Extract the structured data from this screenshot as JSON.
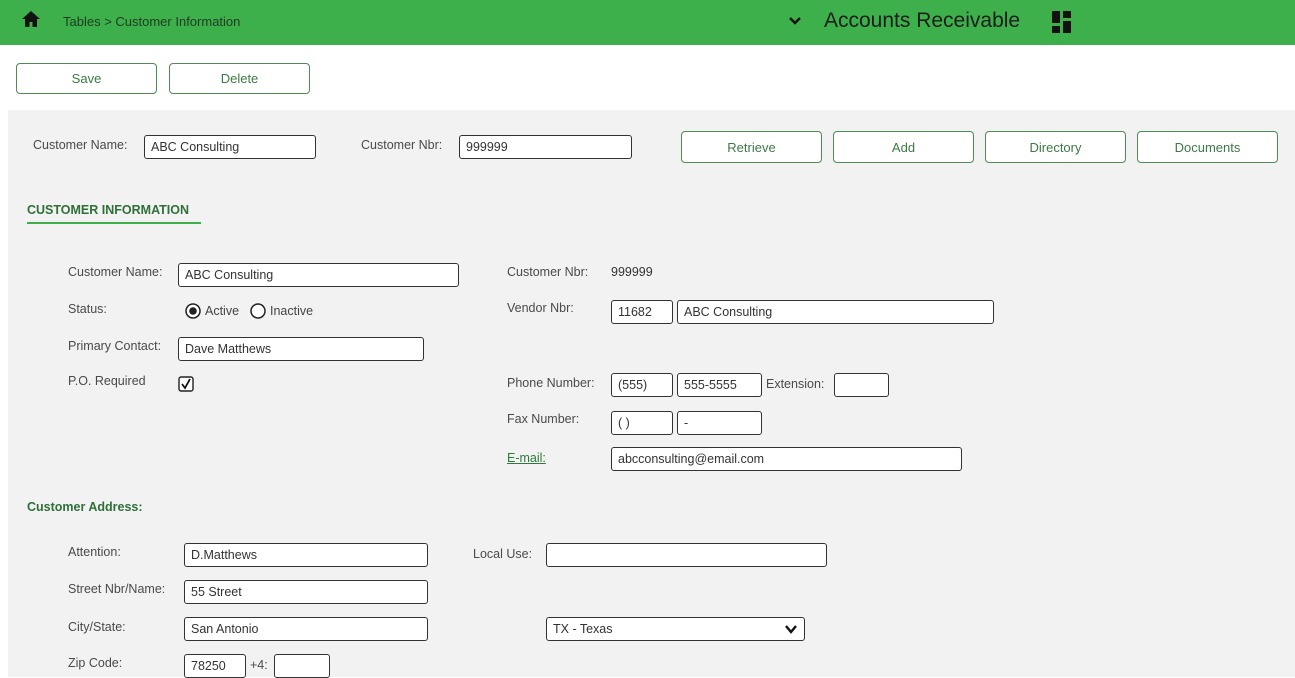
{
  "header": {
    "breadcrumb": "Tables > Customer Information",
    "app_title": "Accounts Receivable"
  },
  "toolbar": {
    "save_label": "Save",
    "delete_label": "Delete"
  },
  "search": {
    "name_label": "Customer Name:",
    "name_value": "ABC Consulting",
    "nbr_label": "Customer Nbr:",
    "nbr_value": "999999",
    "retrieve_label": "Retrieve",
    "add_label": "Add",
    "directory_label": "Directory",
    "documents_label": "Documents"
  },
  "info": {
    "section_title": "CUSTOMER INFORMATION",
    "customer_name_label": "Customer Name:",
    "customer_name_value": "ABC Consulting",
    "status_label": "Status:",
    "status_active": "Active",
    "status_inactive": "Inactive",
    "status_selected": "Active",
    "primary_contact_label": "Primary Contact:",
    "primary_contact_value": "Dave Matthews",
    "po_required_label": "P.O. Required",
    "po_required_checked": true,
    "customer_nbr_label": "Customer Nbr:",
    "customer_nbr_value": "999999",
    "vendor_nbr_label": "Vendor Nbr:",
    "vendor_nbr_value": "11682",
    "vendor_name_value": "ABC Consulting",
    "phone_label": "Phone Number:",
    "phone_area": "(555)",
    "phone_number": "555-5555",
    "extension_label": "Extension:",
    "extension_value": "",
    "fax_label": "Fax Number:",
    "fax_area": "(  )",
    "fax_number": "-",
    "email_label": "E-mail:",
    "email_value": "abcconsulting@email.com"
  },
  "address": {
    "section_title": "Customer Address:",
    "attention_label": "Attention:",
    "attention_value": "D.Matthews",
    "local_use_label": "Local Use:",
    "local_use_value": "",
    "street_label": "Street Nbr/Name:",
    "street_value": "55 Street",
    "city_state_label": "City/State:",
    "city_value": "San Antonio",
    "state_value": "TX - Texas",
    "zip_label": "Zip Code:",
    "zip_value": "78250",
    "plus4_label": "+4:",
    "plus4_value": ""
  },
  "colors": {
    "header_green": "#3db04b",
    "accent_green": "#2f6f38",
    "panel_gray": "#f2f2f2"
  }
}
